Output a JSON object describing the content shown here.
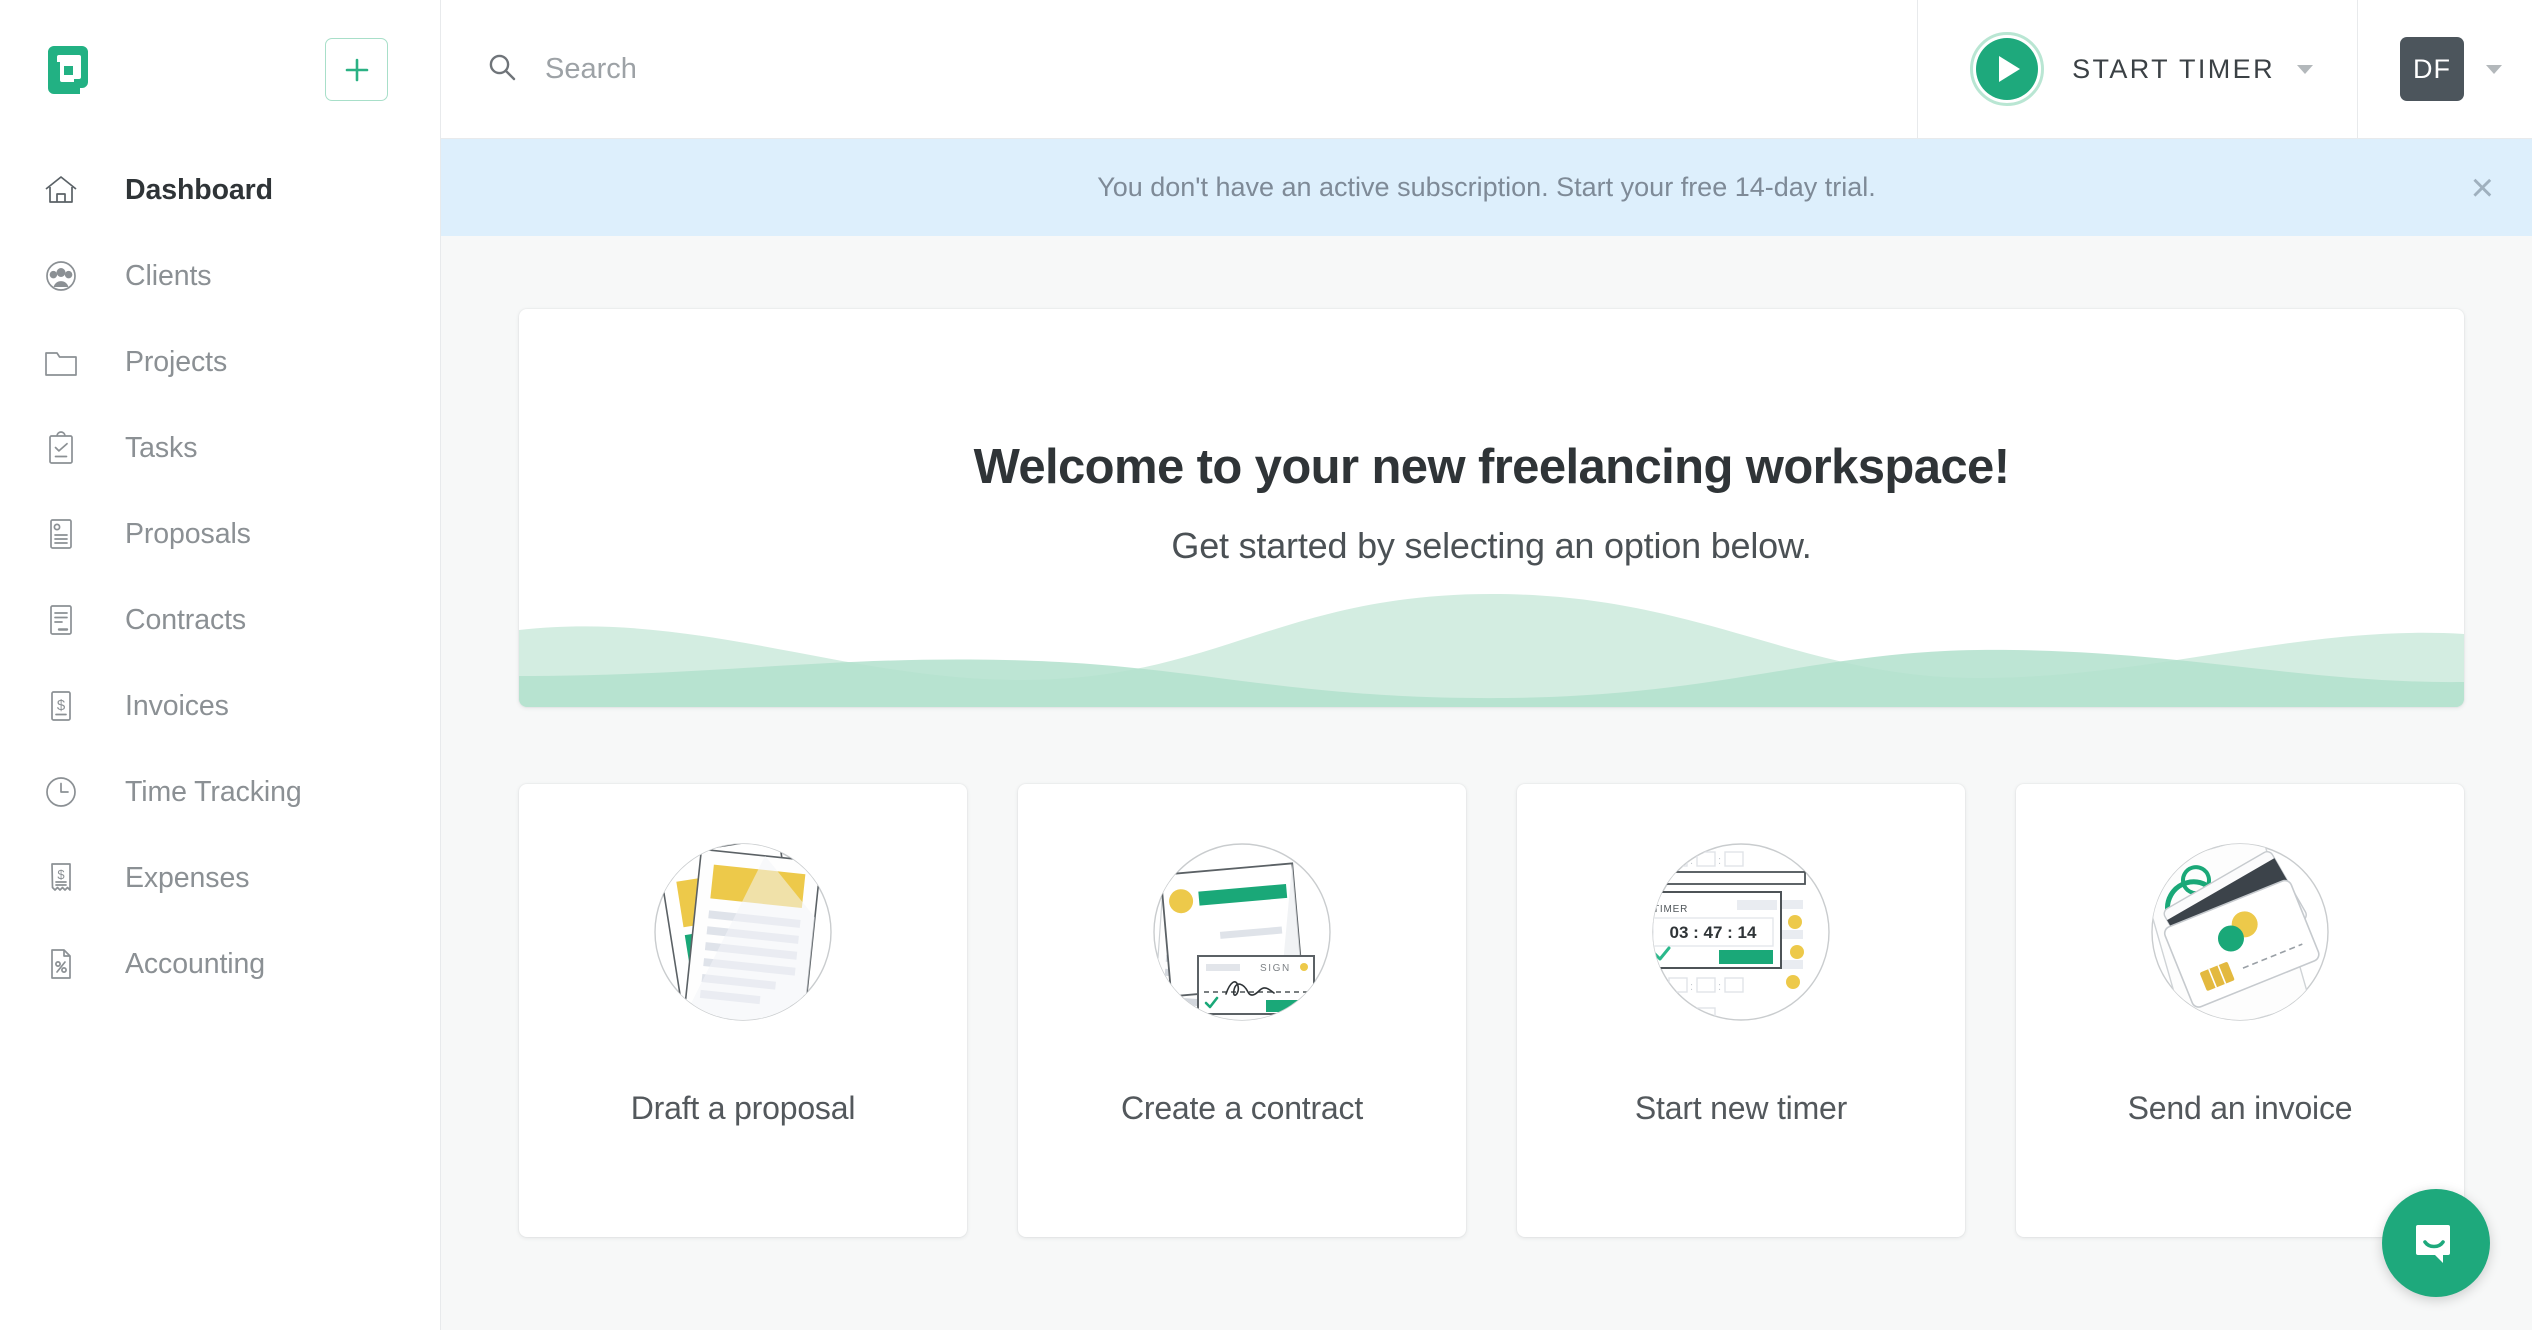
{
  "brand": {
    "accent": "#1ea97c",
    "accent_light": "#a8dfc9",
    "logo_name": "hello-bonsai-logo",
    "background": "#f7f8f8"
  },
  "sidebar": {
    "add_button_label": "+",
    "items": [
      {
        "label": "Dashboard",
        "icon": "home-icon",
        "active": true
      },
      {
        "label": "Clients",
        "icon": "people-icon",
        "active": false
      },
      {
        "label": "Projects",
        "icon": "folder-icon",
        "active": false
      },
      {
        "label": "Tasks",
        "icon": "clipboard-check-icon",
        "active": false
      },
      {
        "label": "Proposals",
        "icon": "proposal-doc-icon",
        "active": false
      },
      {
        "label": "Contracts",
        "icon": "contract-doc-icon",
        "active": false
      },
      {
        "label": "Invoices",
        "icon": "invoice-dollar-icon",
        "active": false
      },
      {
        "label": "Time Tracking",
        "icon": "clock-icon",
        "active": false
      },
      {
        "label": "Expenses",
        "icon": "receipt-icon",
        "active": false
      },
      {
        "label": "Accounting",
        "icon": "percent-doc-icon",
        "active": false
      }
    ]
  },
  "topbar": {
    "search": {
      "placeholder": "Search",
      "value": "",
      "icon": "search-icon"
    },
    "timer": {
      "label": "START TIMER",
      "icon": "play-icon",
      "caret": "chevron-down-icon"
    },
    "user": {
      "initials": "DF",
      "caret": "chevron-down-icon"
    }
  },
  "banner": {
    "message": "You don't have an active subscription. Start your free 14-day trial.",
    "close_label": "×",
    "background": "#ddeffc",
    "text_color": "#7e8a97"
  },
  "welcome": {
    "title": "Welcome to your new freelancing workspace!",
    "subtitle": "Get started by selecting an option below.",
    "wave_color_back": "#d3ede1",
    "wave_color_front": "#b2e0cd"
  },
  "actions": [
    {
      "label": "Draft a proposal",
      "art": "proposal-documents-illustration"
    },
    {
      "label": "Create a contract",
      "art": "contract-signature-illustration"
    },
    {
      "label": "Start new timer",
      "art": "timer-window-illustration",
      "timer_value": "03 : 47 : 14",
      "timer_caption": "TIMER"
    },
    {
      "label": "Send an invoice",
      "art": "credit-cards-illustration"
    }
  ],
  "support": {
    "icon": "intercom-chat-icon",
    "color": "#1ea97c"
  }
}
